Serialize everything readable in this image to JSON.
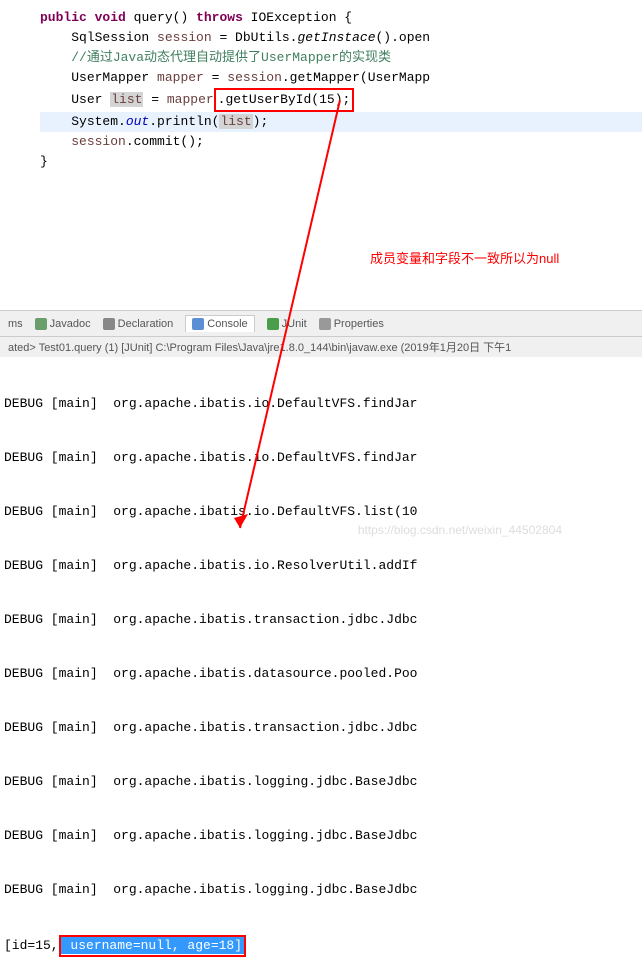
{
  "code": {
    "line1_kw1": "public",
    "line1_kw2": "void",
    "line1_method": " query() ",
    "line1_kw3": "throws",
    "line1_rest": " IOException {",
    "line2_type": "SqlSession ",
    "line2_var": "session",
    "line2_eq": " = DbUtils.",
    "line2_static": "getInstace",
    "line2_rest": "().open",
    "line3_comment": "//通过Java动态代理自动提供了UserMapper的实现类",
    "line4_type": "UserMapper ",
    "line4_var": "mapper",
    "line4_eq": " = ",
    "line4_var2": "session",
    "line4_rest": ".getMapper(UserMapp",
    "line5_type": "User ",
    "line5_var_hl": "list",
    "line5_eq": " = ",
    "line5_var2": "mapper",
    "line5_boxed": ".getUserById(15);",
    "line6_sys": "System.",
    "line6_out": "out",
    "line6_print": ".println(",
    "line6_var_hl": "list",
    "line6_rest": ");",
    "line7_var": "session",
    "line7_rest": ".commit();",
    "line8": "}"
  },
  "annotation": "成员变量和字段不一致所以为null",
  "tabs": {
    "ms": "ms",
    "javadoc": "Javadoc",
    "declaration": "Declaration",
    "console": "Console",
    "junit": "JUnit",
    "properties": "Properties"
  },
  "console_header": "ated> Test01.query (1) [JUnit] C:\\Program Files\\Java\\jre1.8.0_144\\bin\\javaw.exe (2019年1月20日 下午1",
  "console": {
    "rows": [
      "DEBUG [main]  org.apache.ibatis.io.DefaultVFS.findJar",
      "DEBUG [main]  org.apache.ibatis.io.DefaultVFS.findJar",
      "DEBUG [main]  org.apache.ibatis.io.DefaultVFS.list(10",
      "DEBUG [main]  org.apache.ibatis.io.ResolverUtil.addIf",
      "DEBUG [main]  org.apache.ibatis.transaction.jdbc.Jdbc",
      "DEBUG [main]  org.apache.ibatis.datasource.pooled.Poo",
      "DEBUG [main]  org.apache.ibatis.transaction.jdbc.Jdbc",
      "DEBUG [main]  org.apache.ibatis.logging.jdbc.BaseJdbc",
      "DEBUG [main]  org.apache.ibatis.logging.jdbc.BaseJdbc",
      "DEBUG [main]  org.apache.ibatis.logging.jdbc.BaseJdbc"
    ],
    "last_prefix": "[id=15,",
    "last_selected": " username=null, age=18]"
  },
  "watermark": "https://blog.csdn.net/weixin_44502804"
}
